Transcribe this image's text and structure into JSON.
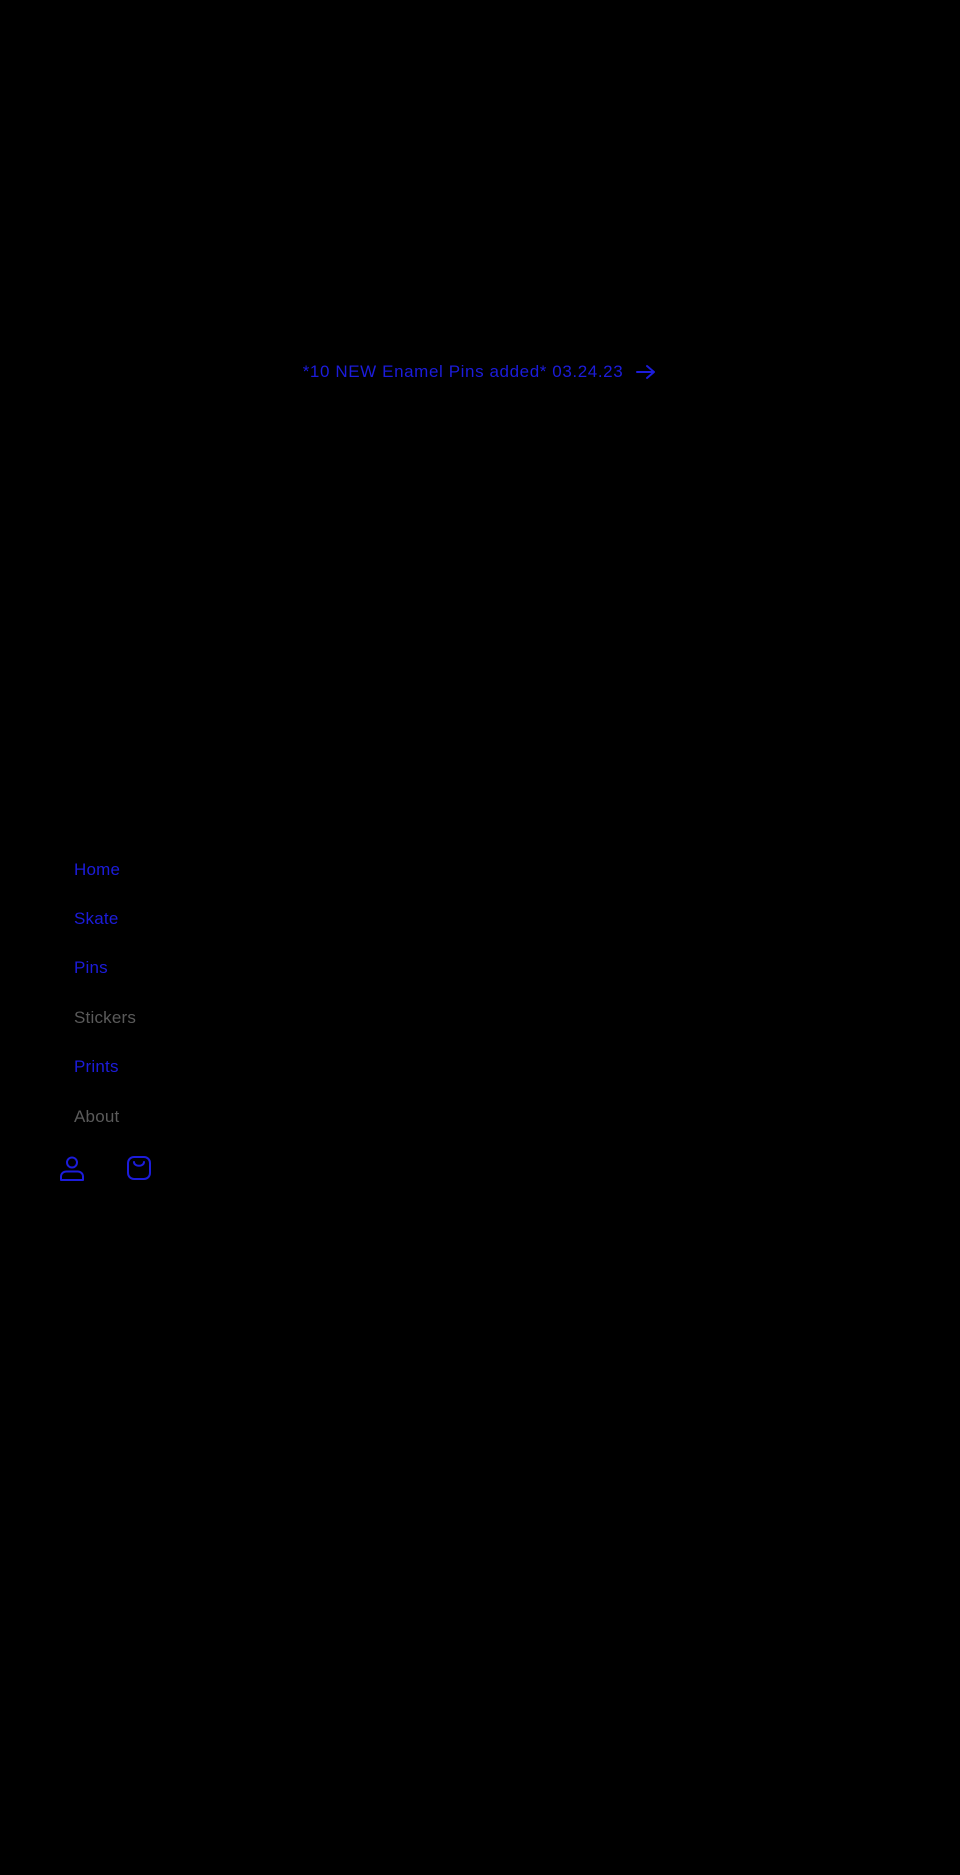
{
  "announcement": {
    "text": "*10 NEW Enamel Pins added* 03.24.23",
    "arrow_icon": "arrow-right-icon"
  },
  "nav": {
    "items": [
      {
        "label": "Home",
        "state": "link"
      },
      {
        "label": "Skate",
        "state": "link"
      },
      {
        "label": "Pins",
        "state": "link"
      },
      {
        "label": "Stickers",
        "state": "visited"
      },
      {
        "label": "Prints",
        "state": "link"
      },
      {
        "label": "About",
        "state": "visited"
      }
    ]
  },
  "header_icons": {
    "account_icon": "account-icon",
    "cart_icon": "cart-icon"
  },
  "colors": {
    "background": "#000000",
    "link": "#1c1cdb",
    "visited": "#5a5a5a"
  }
}
